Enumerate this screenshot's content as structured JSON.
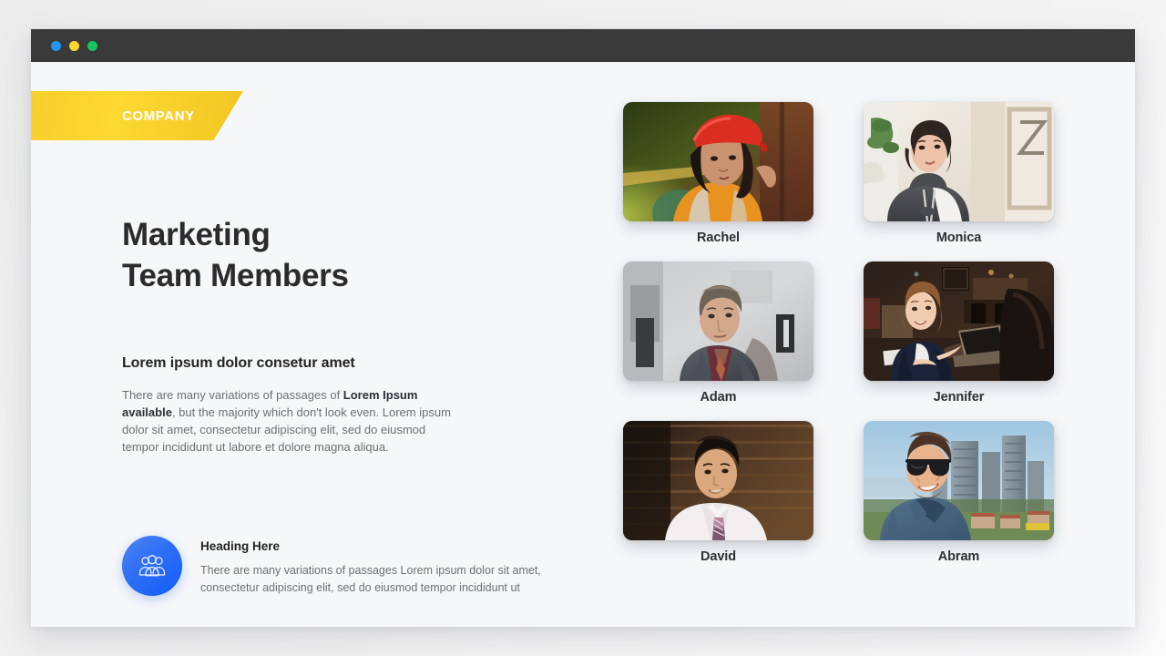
{
  "window": {
    "traffic_lights": [
      {
        "name": "close-dot",
        "color": "#2196f3"
      },
      {
        "name": "minimize-dot",
        "color": "#ffd52e"
      },
      {
        "name": "maximize-dot",
        "color": "#16c45f"
      }
    ]
  },
  "banner": {
    "label": "COMPANY",
    "color": "#fcd832"
  },
  "hero": {
    "title_line1": "Marketing",
    "title_line2": "Team Members",
    "subtitle": "Lorem ipsum dolor consetur amet",
    "paragraph_part1": "There are many variations of passages of ",
    "paragraph_bold": "Lorem Ipsum available",
    "paragraph_part2": ", but the majority which don't look even. Lorem ipsum dolor sit amet, consectetur adipiscing elit, sed do eiusmod tempor incididunt ut labore et dolore magna aliqua."
  },
  "feature": {
    "icon": "users-group-icon",
    "icon_color": "#1f66f4",
    "title": "Heading Here",
    "copy": "There are many variations of passages Lorem ipsum dolor sit amet, consectetur adipiscing elit, sed do eiusmod tempor incididunt ut"
  },
  "team": {
    "members": [
      {
        "name": "Rachel",
        "photo": "woman-red-cap-orange-shirt"
      },
      {
        "name": "Monica",
        "photo": "woman-grey-hoodie-interior"
      },
      {
        "name": "Adam",
        "photo": "man-grey-suit-gallery"
      },
      {
        "name": "Jennifer",
        "photo": "woman-navy-blazer-laptop"
      },
      {
        "name": "David",
        "photo": "man-white-shirt-tie-wood"
      },
      {
        "name": "Abram",
        "photo": "man-sunglasses-cityscape"
      }
    ]
  }
}
